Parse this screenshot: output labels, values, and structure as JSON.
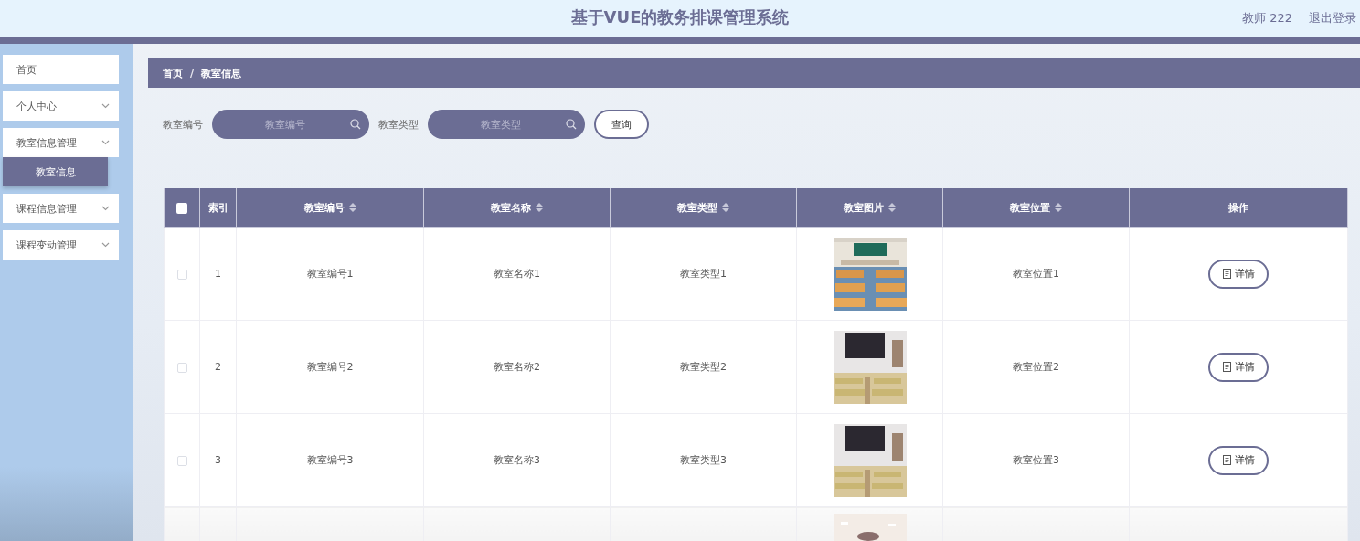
{
  "header": {
    "title": "基于VUE的教务排课管理系统",
    "user": "教师 222",
    "logout": "退出登录"
  },
  "sidebar": {
    "items": [
      {
        "label": "首页",
        "expandable": false,
        "selected": false
      },
      {
        "label": "个人中心",
        "expandable": true,
        "selected": false
      },
      {
        "label": "教室信息管理",
        "expandable": true,
        "selected": false,
        "children": [
          {
            "label": "教室信息",
            "selected": true
          }
        ]
      },
      {
        "label": "课程信息管理",
        "expandable": true,
        "selected": false
      },
      {
        "label": "课程变动管理",
        "expandable": true,
        "selected": false
      }
    ]
  },
  "breadcrumb": {
    "items": [
      "首页",
      "教室信息"
    ],
    "separator": "/"
  },
  "search": {
    "fields": [
      {
        "label": "教室编号",
        "placeholder": "教室编号"
      },
      {
        "label": "教室类型",
        "placeholder": "教室类型"
      }
    ],
    "button": "查询"
  },
  "table": {
    "select_all": {
      "checked": false
    },
    "columns": [
      {
        "label": "索引",
        "sortable": false
      },
      {
        "label": "教室编号",
        "sortable": true
      },
      {
        "label": "教室名称",
        "sortable": true
      },
      {
        "label": "教室类型",
        "sortable": true
      },
      {
        "label": "教室图片",
        "sortable": true
      },
      {
        "label": "教室位置",
        "sortable": true
      },
      {
        "label": "操作",
        "sortable": false
      }
    ],
    "rows": [
      {
        "kind": "full",
        "checked": false,
        "index": "1",
        "number": "教室编号1",
        "name": "教室名称1",
        "type": "教室类型1",
        "location": "教室位置1",
        "action": "详情"
      },
      {
        "kind": "full",
        "checked": false,
        "index": "2",
        "number": "教室编号2",
        "name": "教室名称2",
        "type": "教室类型2",
        "location": "教室位置2",
        "action": "详情"
      },
      {
        "kind": "full",
        "checked": false,
        "index": "3",
        "number": "教室编号3",
        "name": "教室名称3",
        "type": "教室类型3",
        "location": "教室位置3",
        "action": "详情"
      },
      {
        "kind": "cut"
      }
    ]
  }
}
